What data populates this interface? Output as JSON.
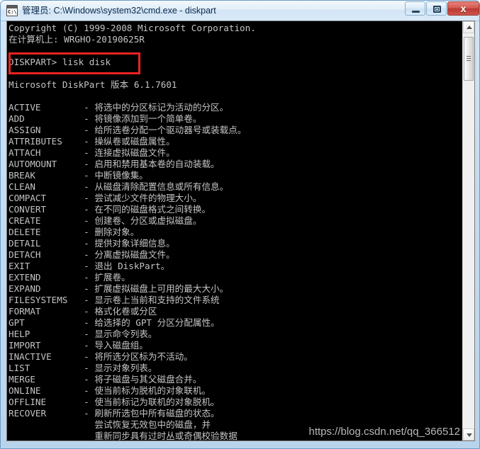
{
  "window": {
    "title": "管理员: C:\\Windows\\system32\\cmd.exe - diskpart",
    "icon": "cmd-console-icon",
    "icon_prompt": "C:\\.",
    "buttons": {
      "minimize": "–",
      "restore": "❐",
      "close": "x"
    }
  },
  "console": {
    "text": "Copyright (C) 1999-2008 Microsoft Corporation.\n在计算机上: WRGHO-20190625R\n\nDISKPART> lisk disk\n\nMicrosoft DiskPart 版本 6.1.7601\n\nACTIVE        - 将选中的分区标记为活动的分区。\nADD           - 将镜像添加到一个简单卷。\nASSIGN        - 给所选卷分配一个驱动器号或装载点。\nATTRIBUTES    - 操纵卷或磁盘属性。\nATTACH        - 连接虚拟磁盘文件。\nAUTOMOUNT     - 启用和禁用基本卷的自动装载。\nBREAK         - 中断镜像集。\nCLEAN         - 从磁盘清除配置信息或所有信息。\nCOMPACT       - 尝试减少文件的物理大小。\nCONVERT       - 在不同的磁盘格式之间转换。\nCREATE        - 创建卷、分区或虚拟磁盘。\nDELETE        - 删除对象。\nDETAIL        - 提供对象详细信息。\nDETACH        - 分离虚拟磁盘文件。\nEXIT          - 退出 DiskPart。\nEXTEND        - 扩展卷。\nEXPAND        - 扩展虚拟磁盘上可用的最大大小。\nFILESYSTEMS   - 显示卷上当前和支持的文件系统\nFORMAT        - 格式化卷或分区\nGPT           - 给选择的 GPT 分区分配属性。\nHELP          - 显示命令列表。\nIMPORT        - 导入磁盘组。\nINACTIVE      - 将所选分区标为不活动。\nLIST          - 显示对象列表。\nMERGE         - 将子磁盘与其父磁盘合并。\nONLINE        - 使当前标为脱机的对象联机。\nOFFLINE       - 使当前标记为联机的对象脱机。\nRECOVER       - 刷新所选包中所有磁盘的状态。\n                尝试恢复无效包中的磁盘，并\n                重新同步具有过时丛或奇偶校验数据",
    "prompt_command": "DISKPART> lisk disk",
    "annotation_color": "#ee2222",
    "foreground_color": "#c4c4c4",
    "background_color": "#000000"
  },
  "scrollbar": {
    "up_arrow": "▲",
    "down_arrow": "▼"
  },
  "watermark": {
    "text": "https://blog.csdn.net/qq_366512"
  }
}
